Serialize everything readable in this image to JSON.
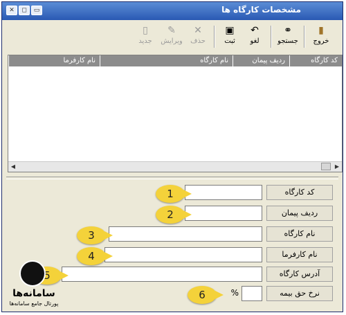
{
  "window": {
    "title": "مشخصات کارگاه ها",
    "controls": {
      "minimize": "▭",
      "maximize": "◻",
      "close": "✕"
    }
  },
  "toolbar": {
    "exit_label": "خروج",
    "search_label": "جستجو",
    "undo_label": "لغو",
    "save_label": "ثبت",
    "delete_label": "حذف",
    "edit_label": "ویرایش",
    "new_label": "جدید"
  },
  "grid": {
    "columns": [
      "کد کارگاه",
      "ردیف پیمان",
      "نام کارگاه",
      "نام کارفرما"
    ]
  },
  "form": {
    "workshop_code_label": "کد کارگاه",
    "contract_row_label": "ردیف پیمان",
    "workshop_name_label": "نام کارگاه",
    "employer_name_label": "نام کارفرما",
    "workshop_address_label": "آدرس کارگاه",
    "insurance_rate_label": "نرخ حق بیمه",
    "percent_sign": "%"
  },
  "badges": [
    "1",
    "2",
    "3",
    "4",
    "5",
    "6"
  ],
  "logo": {
    "name": "سامانه‌ها",
    "tagline": "پورتال جامع سامانه‌ها"
  },
  "colors": {
    "titlebar": "#2a59b3",
    "badge": "#f4d23a",
    "grid_header": "#8c8c8c"
  }
}
